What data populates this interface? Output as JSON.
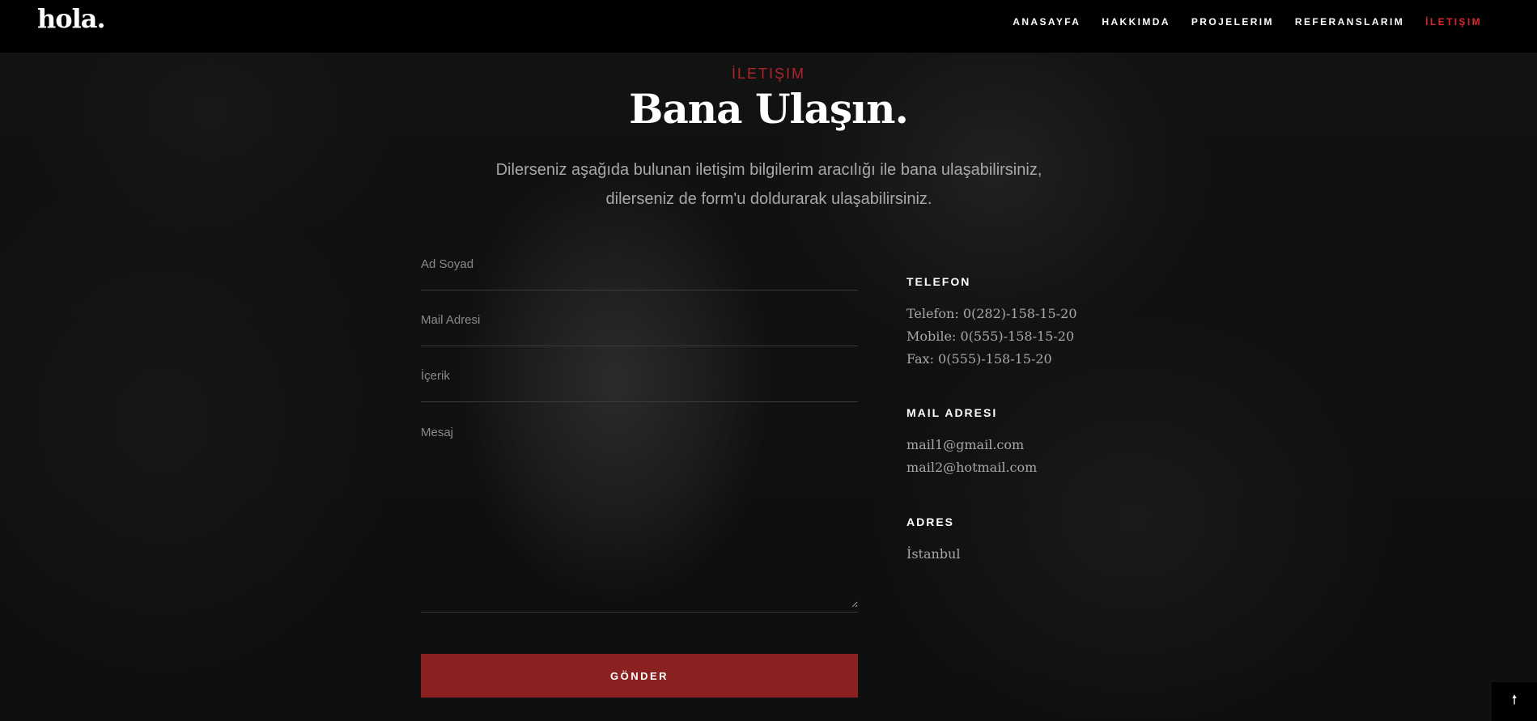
{
  "header": {
    "logo": "hola.",
    "nav": [
      {
        "label": "ANASAYFA"
      },
      {
        "label": "HAKKIMDA"
      },
      {
        "label": "PROJELERIM"
      },
      {
        "label": "REFERANSLARIM"
      },
      {
        "label": "İLETIŞIM",
        "active": true
      }
    ]
  },
  "section": {
    "label": "İLETIŞIM",
    "title": "Bana Ulaşın.",
    "description_line1": "Dilerseniz aşağıda bulunan iletişim bilgilerim aracılığı ile bana ulaşabilirsiniz,",
    "description_line2": "dilerseniz de form'u doldurarak ulaşabilirsiniz."
  },
  "form": {
    "name_placeholder": "Ad Soyad",
    "email_placeholder": "Mail Adresi",
    "subject_placeholder": "İçerik",
    "message_placeholder": "Mesaj",
    "submit_label": "GÖNDER"
  },
  "contact": {
    "phone": {
      "heading": "TELEFON",
      "lines": [
        "Telefon: 0(282)-158-15-20",
        "Mobile: 0(555)-158-15-20",
        "Fax: 0(555)-158-15-20"
      ]
    },
    "mail": {
      "heading": "MAIL ADRESI",
      "lines": [
        "mail1@gmail.com",
        "mail2@hotmail.com"
      ]
    },
    "address": {
      "heading": "ADRES",
      "lines": [
        "İstanbul"
      ]
    }
  },
  "back_to_top": {
    "icon": "arrow-up-icon",
    "glyph": "🠕"
  },
  "colors": {
    "accent": "#8a2020",
    "accent_text": "#d9262c",
    "header_bg": "#000000"
  }
}
